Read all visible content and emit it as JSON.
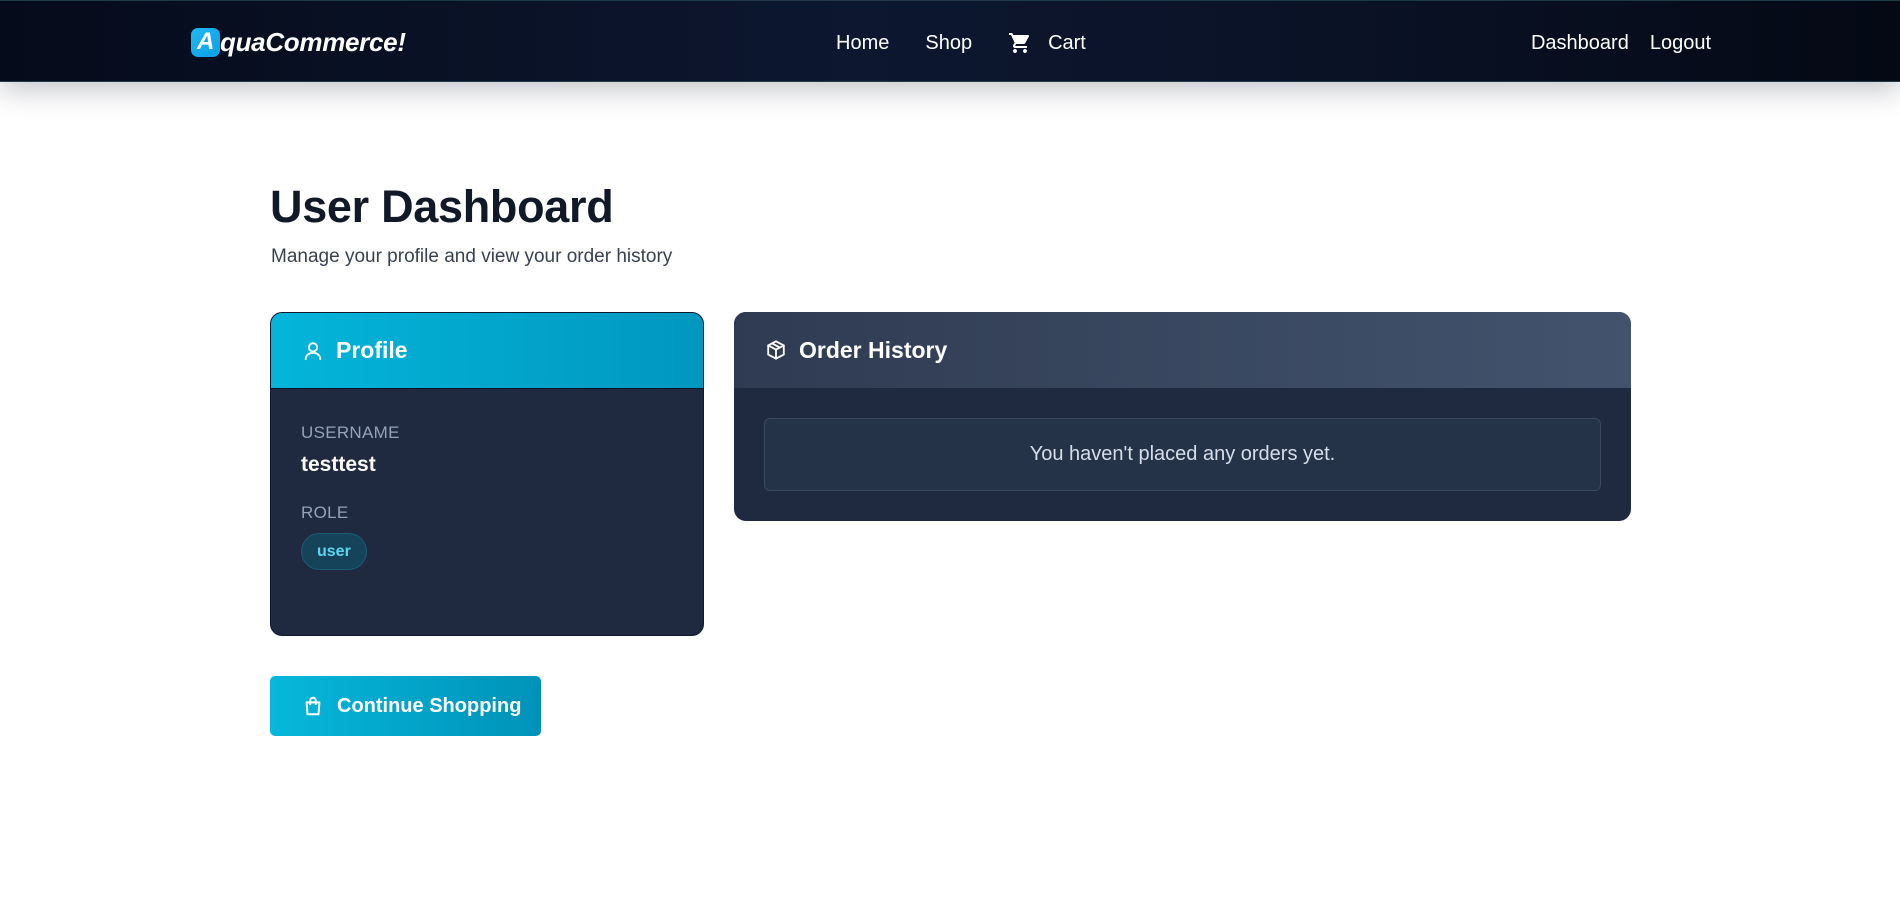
{
  "nav": {
    "brand_letter": "A",
    "brand_rest": "quaCommerce!",
    "links": [
      {
        "label": "Home"
      },
      {
        "label": "Shop"
      },
      {
        "label": "Cart",
        "icon": "cart-icon"
      }
    ],
    "right_links": [
      {
        "label": "Dashboard"
      },
      {
        "label": "Logout"
      }
    ]
  },
  "page": {
    "title": "User Dashboard",
    "subtitle": "Manage your profile and view your order history"
  },
  "profile": {
    "title": "Profile",
    "icon": "user-icon",
    "username_label": "USERNAME",
    "username": "testtest",
    "role_label": "ROLE",
    "role": "user"
  },
  "orders": {
    "title": "Order History",
    "icon": "package-icon",
    "empty_message": "You haven't placed any orders yet."
  },
  "actions": {
    "continue_label": "Continue Shopping",
    "continue_icon": "shopping-bag-icon"
  },
  "colors": {
    "accent": "#06b8db",
    "navbar": "#0a1226",
    "card": "#1f2a40",
    "heading": "#111827"
  }
}
